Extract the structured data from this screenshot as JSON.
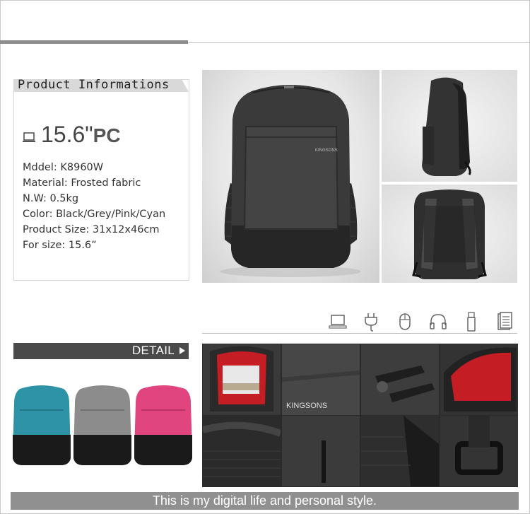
{
  "info": {
    "title": "Product Informations",
    "size_number": "15.6\"",
    "size_suffix": "PC",
    "specs": [
      "Mddel: K8960W",
      "Material: Frosted fabric",
      "N.W: 0.5kg",
      "Color: Black/Grey/Pink/Cyan",
      "Product Size: 31x12x46cm",
      "For size: 15.6”"
    ]
  },
  "brand_on_bag": "KINGSONS",
  "compatible_icons": [
    "laptop-icon",
    "charger-plug-icon",
    "mouse-icon",
    "headphones-icon",
    "usb-drive-icon",
    "document-icon"
  ],
  "detail": {
    "label": "DETAIL"
  },
  "variants": [
    {
      "name": "cyan",
      "color": "#2e93a7"
    },
    {
      "name": "grey",
      "color": "#8c8c8c"
    },
    {
      "name": "pink",
      "color": "#e0457f"
    }
  ],
  "footer": {
    "text": "This is my digital life and personal style."
  },
  "colors": {
    "accent_dark": "#4a4a4a",
    "footer_bg": "#909090",
    "lining_red": "#c41e24"
  }
}
